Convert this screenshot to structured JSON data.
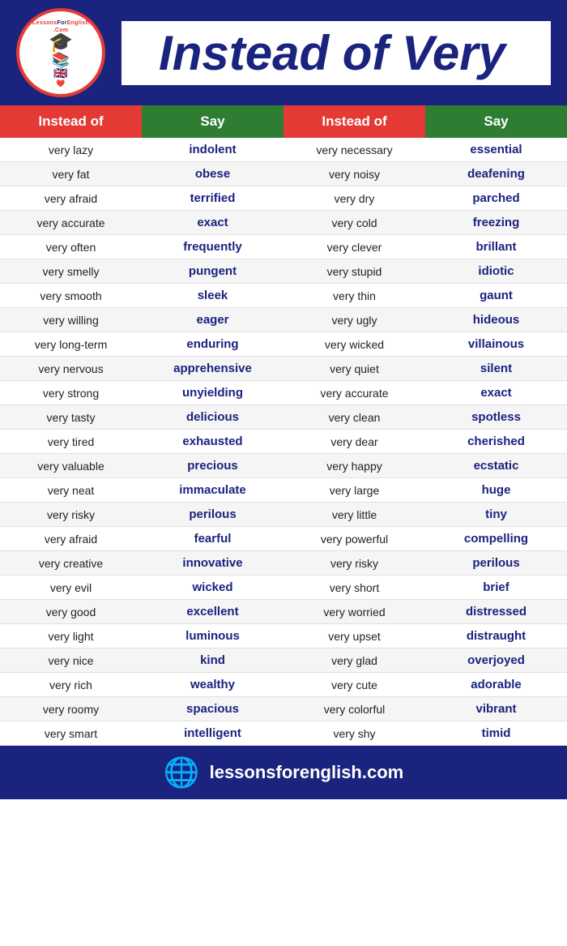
{
  "header": {
    "title": "Instead of Very",
    "logo_alt": "LessonsForEnglish.com",
    "footer_url": "lessonsforenglish.com"
  },
  "table": {
    "col1_header": "Instead of",
    "col2_header": "Say",
    "col3_header": "Instead of",
    "col4_header": "Say",
    "rows": [
      [
        "very lazy",
        "indolent",
        "very necessary",
        "essential"
      ],
      [
        "very fat",
        "obese",
        "very noisy",
        "deafening"
      ],
      [
        "very afraid",
        "terrified",
        "very dry",
        "parched"
      ],
      [
        "very accurate",
        "exact",
        "very cold",
        "freezing"
      ],
      [
        "very often",
        "frequently",
        "very clever",
        "brillant"
      ],
      [
        "very smelly",
        "pungent",
        "very stupid",
        "idiotic"
      ],
      [
        "very smooth",
        "sleek",
        "very thin",
        "gaunt"
      ],
      [
        "very willing",
        "eager",
        "very ugly",
        "hideous"
      ],
      [
        "very long-term",
        "enduring",
        "very wicked",
        "villainous"
      ],
      [
        "very nervous",
        "apprehensive",
        "very quiet",
        "silent"
      ],
      [
        "very strong",
        "unyielding",
        "very accurate",
        "exact"
      ],
      [
        "very tasty",
        "delicious",
        "very clean",
        "spotless"
      ],
      [
        "very tired",
        "exhausted",
        "very dear",
        "cherished"
      ],
      [
        "very valuable",
        "precious",
        "very happy",
        "ecstatic"
      ],
      [
        "very neat",
        "immaculate",
        "very large",
        "huge"
      ],
      [
        "very risky",
        "perilous",
        "very little",
        "tiny"
      ],
      [
        "very afraid",
        "fearful",
        "very powerful",
        "compelling"
      ],
      [
        "very creative",
        "innovative",
        "very risky",
        "perilous"
      ],
      [
        "very evil",
        "wicked",
        "very short",
        "brief"
      ],
      [
        "very good",
        "excellent",
        "very worried",
        "distressed"
      ],
      [
        "very light",
        "luminous",
        "very upset",
        "distraught"
      ],
      [
        "very nice",
        "kind",
        "very glad",
        "overjoyed"
      ],
      [
        "very rich",
        "wealthy",
        "very cute",
        "adorable"
      ],
      [
        "very roomy",
        "spacious",
        "very colorful",
        "vibrant"
      ],
      [
        "very smart",
        "intelligent",
        "very shy",
        "timid"
      ]
    ]
  }
}
